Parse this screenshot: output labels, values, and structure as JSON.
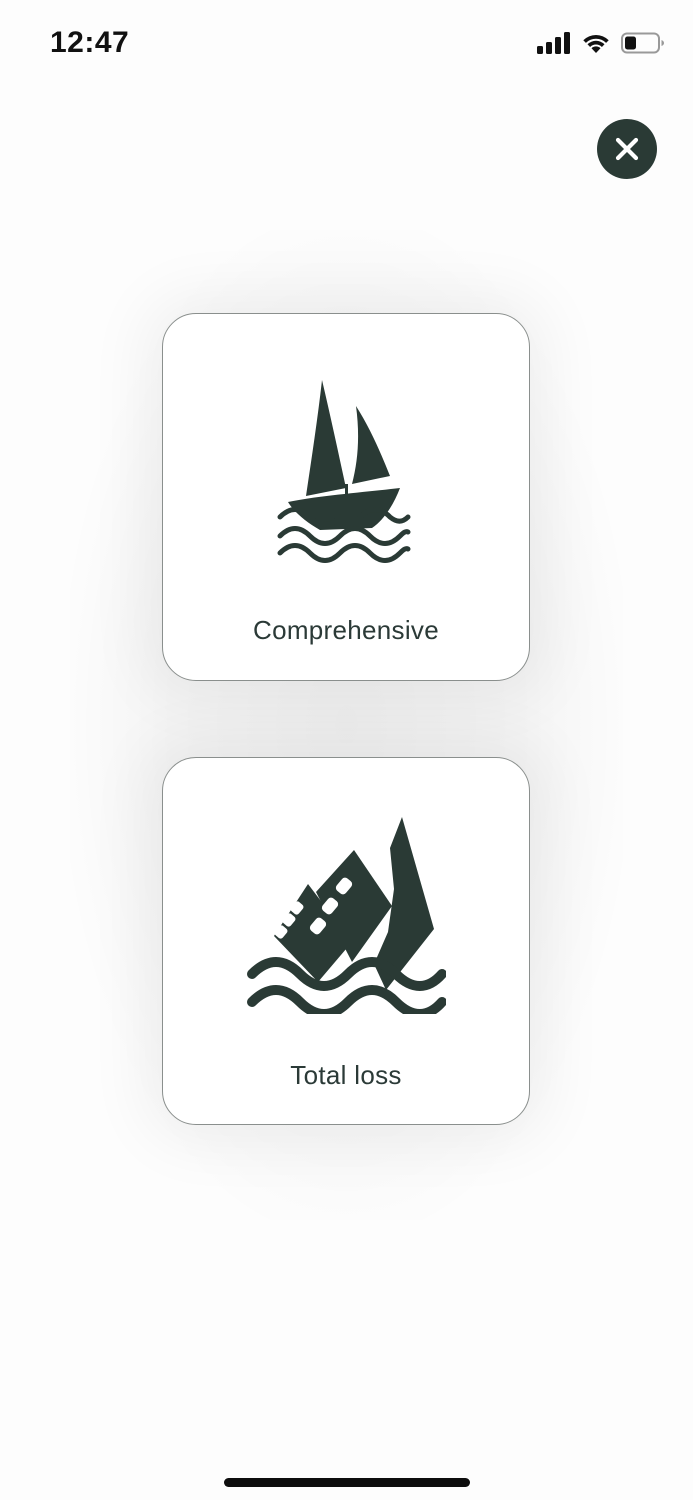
{
  "status_bar": {
    "time": "12:47"
  },
  "options": [
    {
      "label": "Comprehensive",
      "icon": "sailboat-icon"
    },
    {
      "label": "Total loss",
      "icon": "sinking-ship-icon"
    }
  ],
  "colors": {
    "primary": "#2a3a35",
    "text": "#2b3a37",
    "card_border": "#8a8f8d",
    "background": "#fdfdfd"
  }
}
